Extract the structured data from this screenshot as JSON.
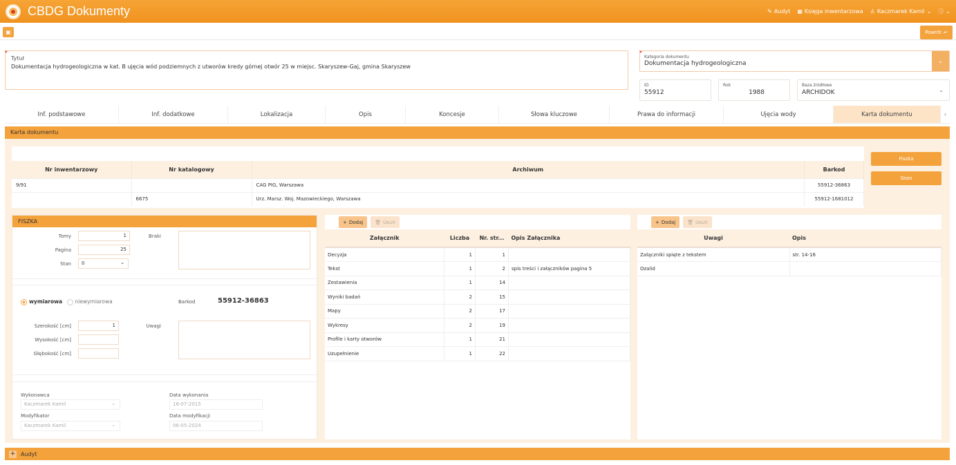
{
  "app": {
    "title": "CBDG Dokumenty"
  },
  "topnav": {
    "audyt": "Audyt",
    "ksiega": "Księga inwentarzowa",
    "user": "Kaczmarek Kamil",
    "help_icon": "help-icon"
  },
  "toolbar": {
    "powrot": "Powrót"
  },
  "form": {
    "tytul_label": "Tytuł",
    "tytul_value": "Dokumentacja hydrogeologiczna w kat. B ujęcia wód podziemnych z utworów kredy górnej otwór 25 w miejsc. Skaryszew-Gaj, gmina Skaryszew",
    "kategoria_label": "Kategoria dokumentu",
    "kategoria_value": "Dokumentacja hydrogeologiczna",
    "id_label": "ID",
    "id_value": "55912",
    "rok_label": "Rok",
    "rok_value": "1988",
    "baza_label": "Baza źródłowe",
    "baza_value": "ARCHIDOK"
  },
  "tabs": [
    "Inf. podstawowe",
    "Inf. dodatkowe",
    "Lokalizacja",
    "Opis",
    "Koncesje",
    "Słowa kluczowe",
    "Prawa do informacji",
    "Ujęcia wody",
    "Karta dokumentu"
  ],
  "panel": {
    "title": "Karta dokumentu"
  },
  "inventory": {
    "headers": [
      "Nr inwentarzowy",
      "Nr katalogowy",
      "Archiwum",
      "Barkod"
    ],
    "rows": [
      [
        "9/91",
        "",
        "CAG PIG, Warszawa",
        "55912-36863"
      ],
      [
        "",
        "6675",
        "Urz. Marsz. Woj. Mazowieckiego, Warszawa",
        "55912-1681012"
      ]
    ],
    "fiszka_btn": "Fiszka",
    "skan_btn": "Skan"
  },
  "fiszka": {
    "title": "FISZKA",
    "tomy_label": "Tomy",
    "tomy": "1",
    "pagina_label": "Pagina",
    "pagina": "25",
    "stan_label": "Stan",
    "stan": "0",
    "braki_label": "Braki",
    "wymiarowa": "wymiarowa",
    "niewymiarowa": "niewymiarowa",
    "barkod_label": "Barkod",
    "barkod": "55912-36863",
    "szerokosc_label": "Szerokość [cm]",
    "szerokosc": "1",
    "wysokosc_label": "Wysokość [cm]",
    "glebokosc_label": "Głębokość [cm]",
    "uwagi_label": "Uwagi",
    "wykonawca_label": "Wykonawca",
    "wykonawca": "Kaczmarek Kamil",
    "data_wyk_label": "Data wykonania",
    "data_wyk": "16-07-2015",
    "modyfikator_label": "Modyfikator",
    "modyfikator": "Kaczmarek Kamil",
    "data_mod_label": "Data modyfikacji",
    "data_mod": "06-05-2024"
  },
  "grid_buttons": {
    "dodaj": "Dodaj",
    "usun": "Usuń"
  },
  "attachments": {
    "headers": [
      "Załącznik",
      "Liczba",
      "Nr. str...",
      "Opis Załącznika"
    ],
    "rows": [
      [
        "Decyzja",
        "1",
        "1",
        ""
      ],
      [
        "Tekst",
        "1",
        "2",
        "spis treści i załączników pagina 5"
      ],
      [
        "Zestawienia",
        "1",
        "14",
        ""
      ],
      [
        "Wyniki badań",
        "2",
        "15",
        ""
      ],
      [
        "Mapy",
        "2",
        "17",
        ""
      ],
      [
        "Wykresy",
        "2",
        "19",
        ""
      ],
      [
        "Profile i karty otworów",
        "1",
        "21",
        ""
      ],
      [
        "Uzupełnienie",
        "1",
        "22",
        ""
      ]
    ]
  },
  "uwagi": {
    "headers": [
      "Uwagi",
      "Opis"
    ],
    "rows": [
      [
        "Załączniki spięte z tekstem",
        "str. 14-16"
      ],
      [
        "Ozalid",
        ""
      ]
    ]
  },
  "audyt": {
    "label": "Audyt"
  }
}
